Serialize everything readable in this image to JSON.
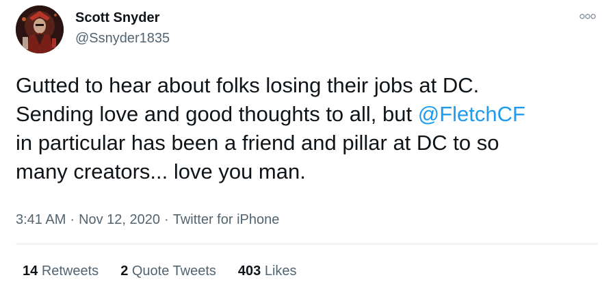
{
  "author": {
    "name": "Scott Snyder",
    "handle": "@Ssnyder1835"
  },
  "tweet": {
    "lines": [
      "Gutted to hear about folks losing their jobs at DC.",
      {
        "before": "Sending love and good thoughts to all, but ",
        "mention": "@FletchCF"
      },
      "in particular has been a friend and pillar at DC to so",
      "many creators... love you man."
    ]
  },
  "meta": {
    "time": "3:41 AM",
    "separator": "·",
    "date": "Nov 12, 2020",
    "source": "Twitter for iPhone"
  },
  "stats": {
    "retweets_count": "14",
    "retweets_label": "Retweets",
    "quotes_count": "2",
    "quotes_label": "Quote Tweets",
    "likes_count": "403",
    "likes_label": "Likes"
  },
  "colors": {
    "text": "#0f1419",
    "secondary": "#536471",
    "link": "#1d9bf0",
    "divider": "#e6e9ec"
  },
  "icons": {
    "more": "more-options-icon",
    "avatar": "user-avatar"
  }
}
